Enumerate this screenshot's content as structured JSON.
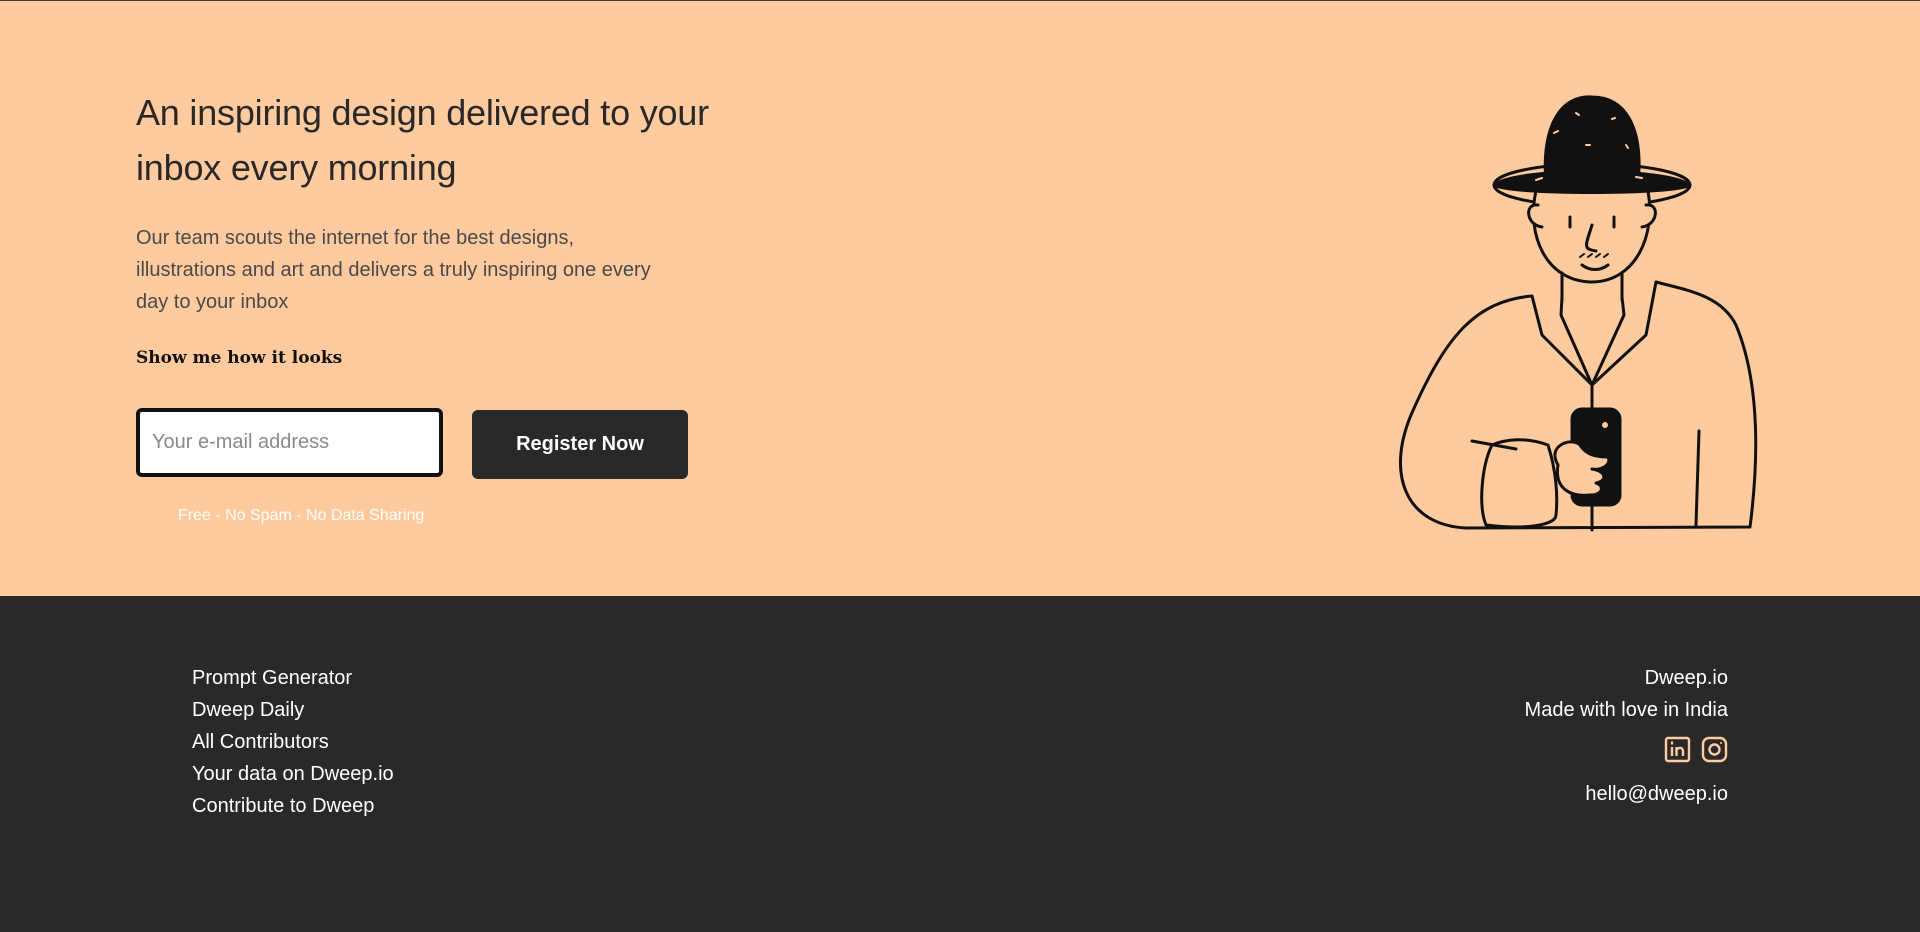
{
  "hero": {
    "title": "An inspiring design delivered to your inbox every morning",
    "description": "Our team scouts the internet for the best designs, illustrations and art and delivers a truly inspiring one every day to your inbox",
    "show_link": "Show me how it looks",
    "email_placeholder": "Your e-mail address",
    "register_label": "Register Now",
    "fine_print": "Free - No Spam - No Data Sharing"
  },
  "footer": {
    "links": [
      "Prompt Generator",
      "Dweep Daily",
      "All Contributors",
      "Your data on Dweep.io",
      "Contribute to Dweep"
    ],
    "brand": "Dweep.io",
    "tagline": "Made with love in India",
    "social_icons": [
      "linkedin-icon",
      "instagram-icon"
    ],
    "email": "hello@dweep.io"
  },
  "colors": {
    "hero_bg": "#ffca9d",
    "dark": "#292929",
    "accent_icon": "#ffca9d"
  }
}
